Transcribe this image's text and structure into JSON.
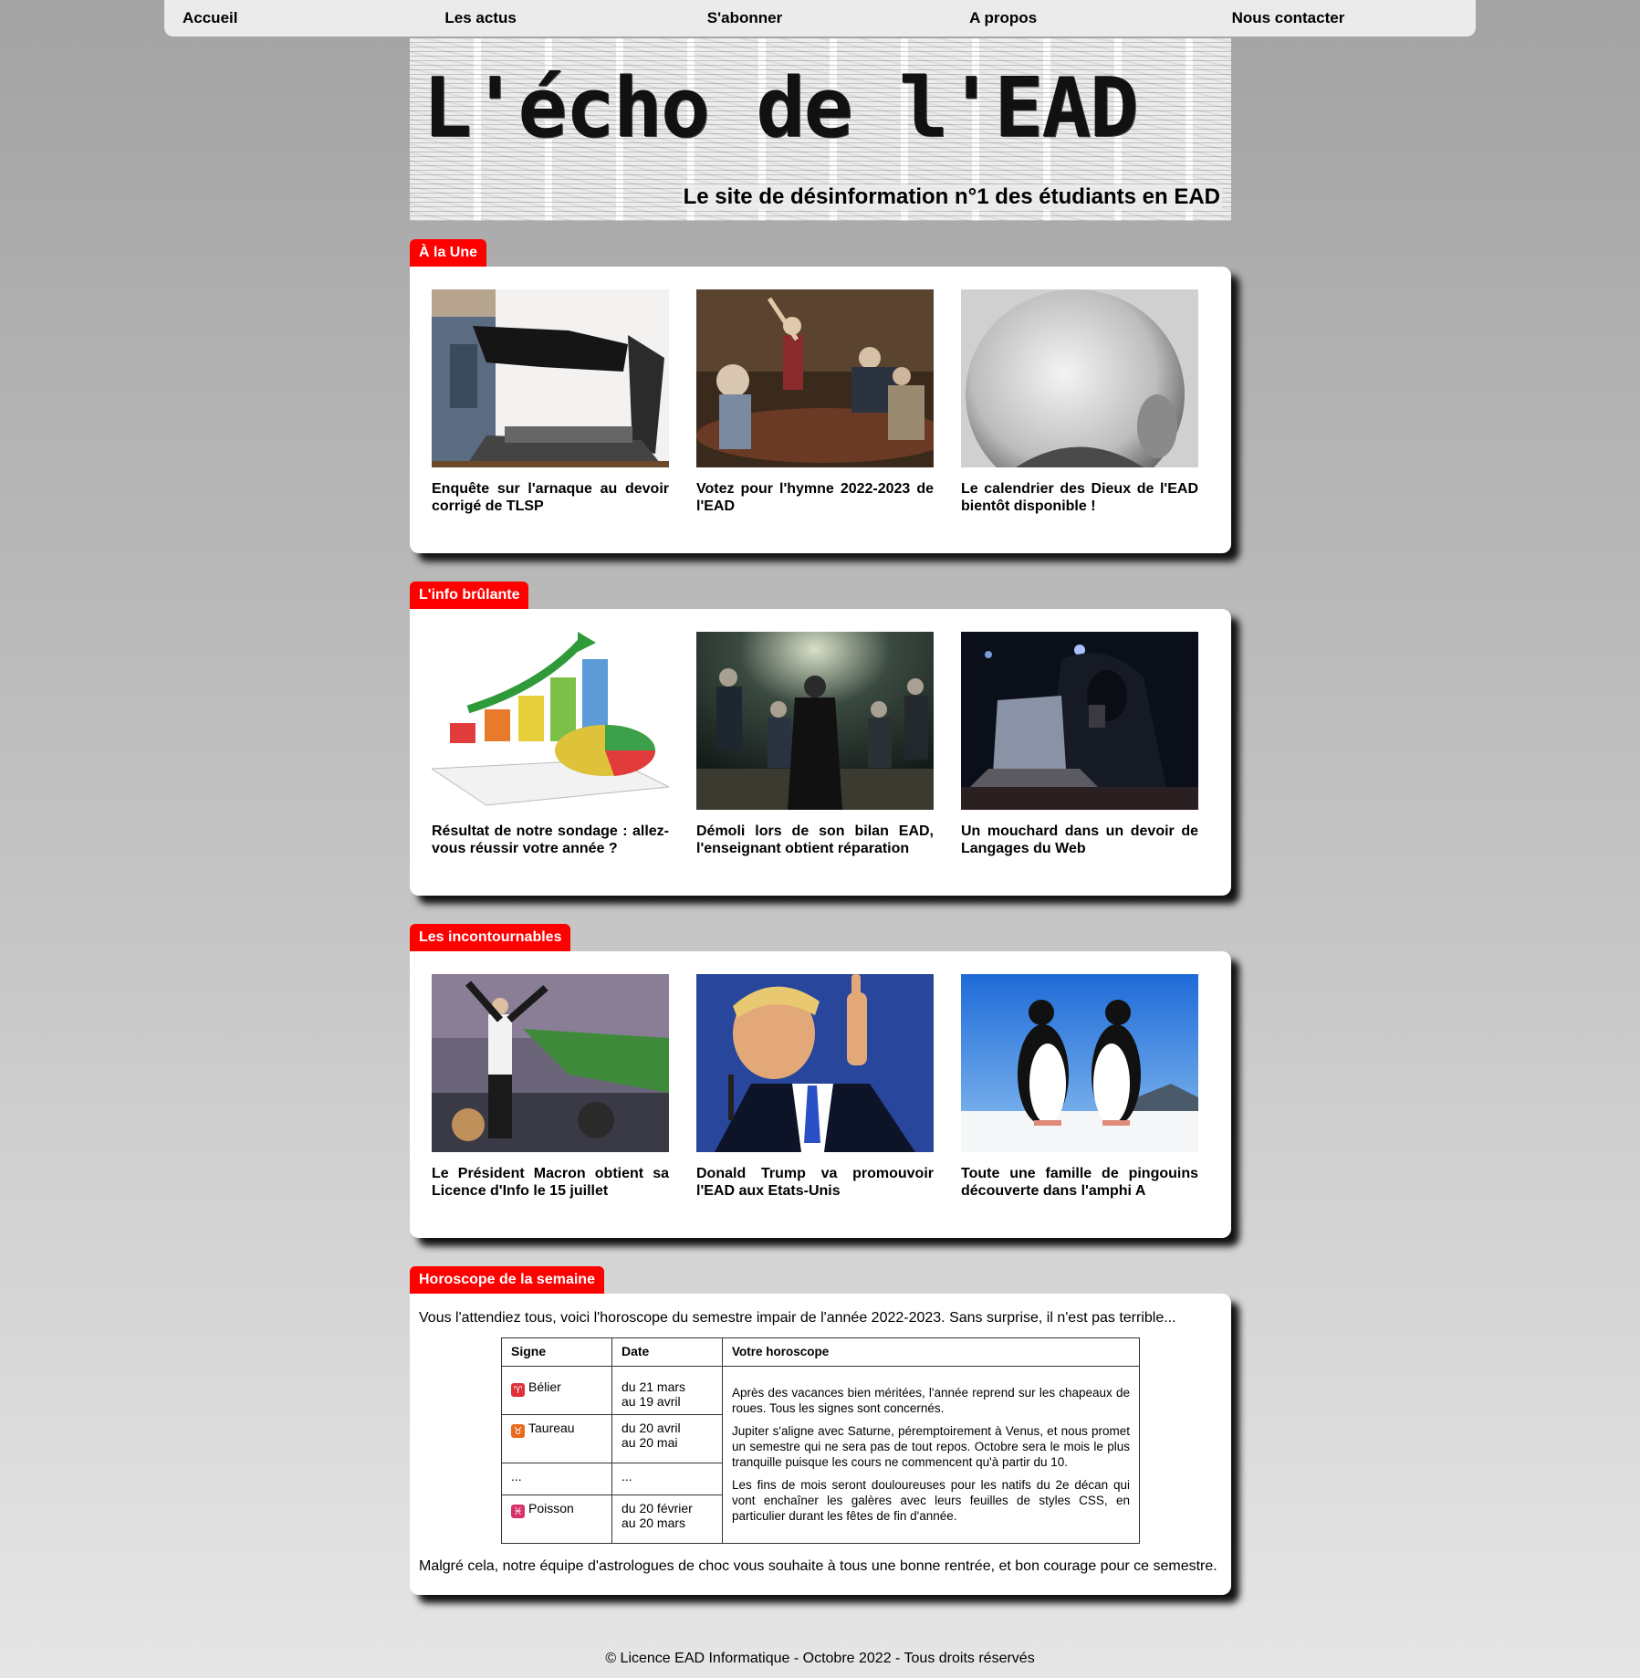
{
  "nav": {
    "items": [
      {
        "label": "Accueil"
      },
      {
        "label": "Les actus"
      },
      {
        "label": "S'abonner"
      },
      {
        "label": "A propos"
      },
      {
        "label": "Nous contacter"
      }
    ]
  },
  "banner": {
    "title": "L'écho de l'EAD",
    "subtitle": "Le site de désinformation n°1 des étudiants en EAD"
  },
  "sections": [
    {
      "title": "À la Une",
      "articles": [
        {
          "headline": "Enquête sur l'arnaque au devoir corrigé de TLSP",
          "image": "laptop-thief-image"
        },
        {
          "headline": "Votez pour l'hymne 2022-2023 de l'EAD",
          "image": "painting-singer-image"
        },
        {
          "headline": "Le calendrier des Dieux de l'EAD bientôt disponible !",
          "image": "bald-head-image"
        }
      ]
    },
    {
      "title": "L'info brûlante",
      "articles": [
        {
          "headline": "Résultat de notre sondage : allez-vous réussir votre année ?",
          "image": "chart-3d-image"
        },
        {
          "headline": "Démoli lors de son bilan EAD, l'enseignant obtient réparation",
          "image": "group-kneeling-image"
        },
        {
          "headline": "Un mouchard dans un devoir de Langages du Web",
          "image": "hooded-hacker-image"
        }
      ]
    },
    {
      "title": "Les incontournables",
      "articles": [
        {
          "headline": "Le Président Macron obtient sa Licence d'Info le 15 juillet",
          "image": "stadium-celebration-image"
        },
        {
          "headline": "Donald Trump va promouvoir l'EAD aux Etats-Unis",
          "image": "pointing-man-image"
        },
        {
          "headline": "Toute une famille de pingouins découverte dans l'amphi A",
          "image": "penguins-image"
        }
      ]
    }
  ],
  "horoscope": {
    "title": "Horoscope de la semaine",
    "intro": "Vous l'attendiez tous, voici l'horoscope du semestre impair de l'année 2022-2023. Sans surprise, il n'est pas terrible...",
    "headers": {
      "sign": "Signe",
      "date": "Date",
      "text": "Votre horoscope"
    },
    "rows": [
      {
        "sign": "Bélier",
        "glyph": "♈",
        "color": "#e0303a",
        "date1": "du 21 mars",
        "date2": "au 19 avril"
      },
      {
        "sign": "Taureau",
        "glyph": "♉",
        "color": "#e86a1e",
        "date1": "du 20 avril",
        "date2": "au 20 mai"
      },
      {
        "sign": "...",
        "glyph": "",
        "color": "",
        "date1": "...",
        "date2": ""
      },
      {
        "sign": "Poisson",
        "glyph": "♓",
        "color": "#d6336c",
        "date1": "du 20 février",
        "date2": "au 20 mars"
      }
    ],
    "paragraphs": [
      "Après des vacances bien méritées, l'année reprend sur les chapeaux de roues. Tous les signes sont concernés.",
      "Jupiter s'aligne avec Saturne, péremptoirement à Venus, et nous promet un semestre qui ne sera pas de tout repos. Octobre sera le mois le plus tranquille puisque les cours ne commencent qu'à partir du 10.",
      "Les fins de mois seront douloureuses pour les natifs du 2e décan qui vont enchaîner les galères avec leurs feuilles de styles CSS, en particulier durant les fêtes de fin d'année."
    ],
    "outro": "Malgré cela, notre équipe d'astrologues de choc vous souhaite à tous une bonne rentrée, et bon courage pour ce semestre."
  },
  "footer": {
    "text": "© Licence EAD Informatique - Octobre 2022 - Tous droits réservés"
  },
  "colors": {
    "accent": "#ff0000",
    "nav_bg": "#ebebeb",
    "card_bg": "#ffffff"
  }
}
